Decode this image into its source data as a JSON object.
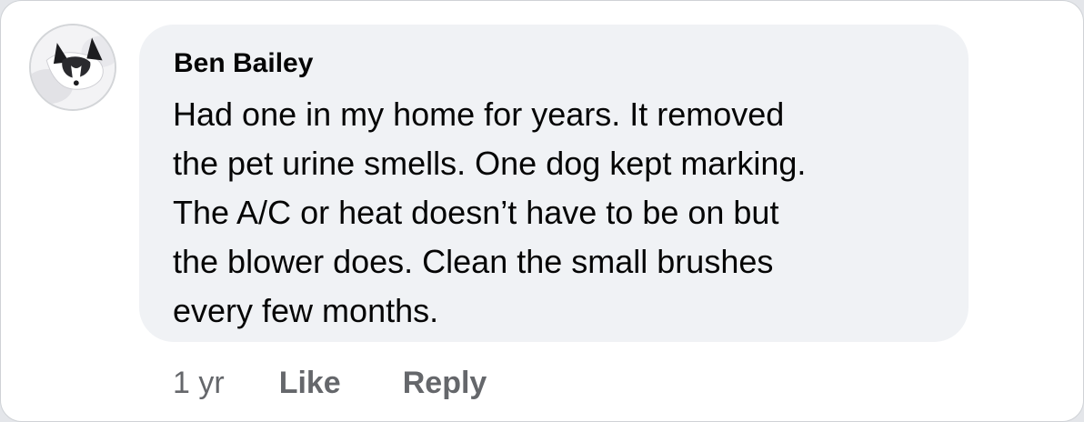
{
  "comment": {
    "avatar_icon": "user-avatar-dog-photo",
    "author": "Ben Bailey",
    "text_lines": [
      "Had one in my home for years. It removed",
      "the pet urine smells. One dog kept marking.",
      "The A/C or heat doesn’t have to be on but",
      "the blower does. Clean the small brushes",
      "every few months."
    ],
    "timestamp": "1 yr",
    "like_label": "Like",
    "reply_label": "Reply"
  },
  "colors": {
    "bubble_bg": "#f0f2f5",
    "text": "#050505",
    "secondary_text": "#65676b"
  }
}
